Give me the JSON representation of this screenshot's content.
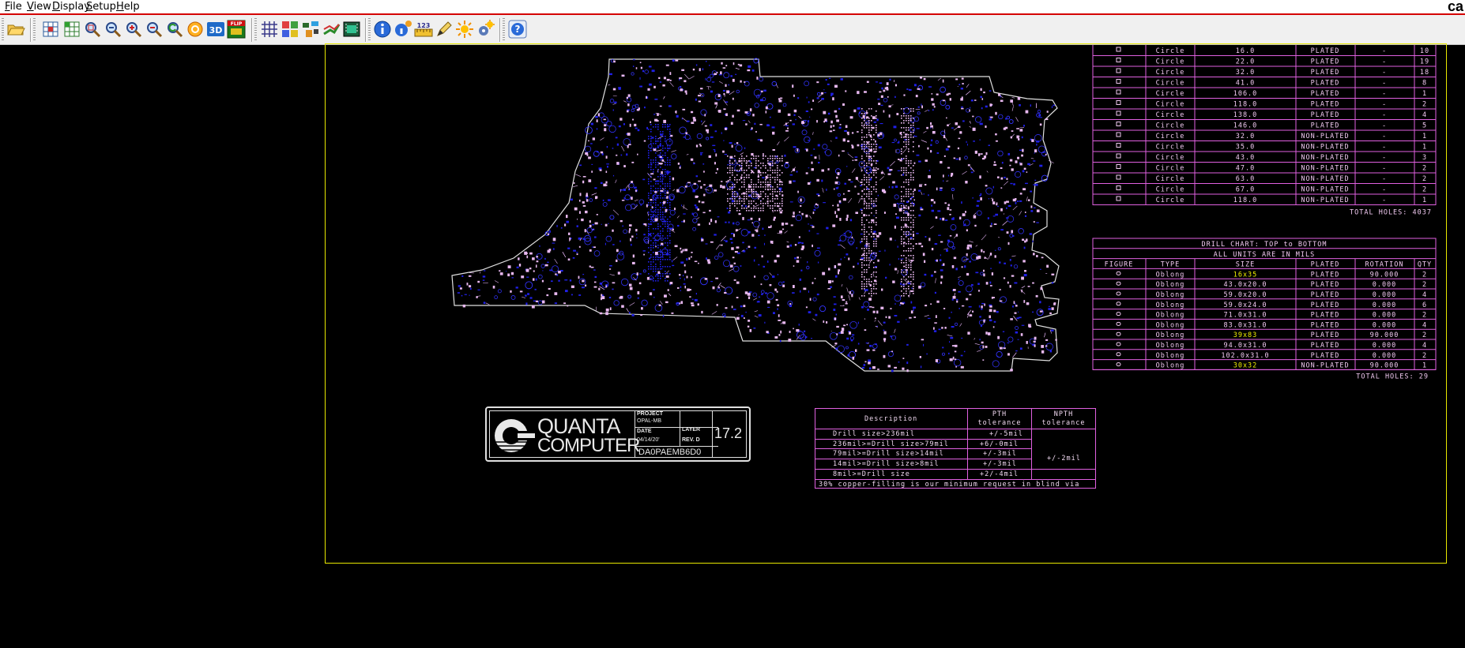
{
  "menu": [
    "File",
    "View",
    "Display",
    "Setup",
    "Help"
  ],
  "brand": "ca",
  "toolbar": {
    "icons": [
      "open-folder-icon",
      "grid-view-icon",
      "grid-view-2-icon",
      "zoom-area-icon",
      "zoom-fit-icon",
      "zoom-in-icon",
      "zoom-out-icon",
      "zoom-previous-icon",
      "refresh-icon",
      "view-3d-icon",
      "flip-board-icon",
      "grid-toggle-icon",
      "layers-icon",
      "components-icon",
      "nets-icon",
      "board-icon",
      "info-icon",
      "properties-icon",
      "measure-icon",
      "highlight-icon",
      "brightness-icon",
      "settings-icon",
      "help-icon"
    ],
    "label_3d": "3D",
    "label_flip": "FLIP",
    "label_measure": "123"
  },
  "drill_chart_upper": {
    "rows": [
      [
        "Circle",
        "16.0",
        "PLATED",
        "-",
        "10"
      ],
      [
        "Circle",
        "22.0",
        "PLATED",
        "-",
        "19"
      ],
      [
        "Circle",
        "32.0",
        "PLATED",
        "-",
        "18"
      ],
      [
        "Circle",
        "41.0",
        "PLATED",
        "-",
        "8"
      ],
      [
        "Circle",
        "106.0",
        "PLATED",
        "-",
        "1"
      ],
      [
        "Circle",
        "118.0",
        "PLATED",
        "-",
        "2"
      ],
      [
        "Circle",
        "138.0",
        "PLATED",
        "-",
        "4"
      ],
      [
        "Circle",
        "146.0",
        "PLATED",
        "-",
        "5"
      ],
      [
        "Circle",
        "32.0",
        "NON-PLATED",
        "-",
        "1"
      ],
      [
        "Circle",
        "35.0",
        "NON-PLATED",
        "-",
        "1"
      ],
      [
        "Circle",
        "43.0",
        "NON-PLATED",
        "-",
        "3"
      ],
      [
        "Circle",
        "47.0",
        "NON-PLATED",
        "-",
        "2"
      ],
      [
        "Circle",
        "63.0",
        "NON-PLATED",
        "-",
        "2"
      ],
      [
        "Circle",
        "67.0",
        "NON-PLATED",
        "-",
        "2"
      ],
      [
        "Circle",
        "118.0",
        "NON-PLATED",
        "-",
        "1"
      ]
    ],
    "total": "TOTAL HOLES:  4037"
  },
  "drill_chart_lower": {
    "title": "DRILL CHART: TOP to BOTTOM",
    "subtitle": "ALL UNITS ARE IN MILS",
    "headers": [
      "FIGURE",
      "TYPE",
      "SIZE",
      "PLATED",
      "ROTATION",
      "QTY"
    ],
    "rows": [
      [
        "Oblong",
        "16x35",
        "PLATED",
        "90.000",
        "2"
      ],
      [
        "Oblong",
        "43.0x20.0",
        "PLATED",
        "0.000",
        "2"
      ],
      [
        "Oblong",
        "59.0x20.0",
        "PLATED",
        "0.000",
        "4"
      ],
      [
        "Oblong",
        "59.0x24.0",
        "PLATED",
        "0.000",
        "6"
      ],
      [
        "Oblong",
        "71.0x31.0",
        "PLATED",
        "0.000",
        "2"
      ],
      [
        "Oblong",
        "83.0x31.0",
        "PLATED",
        "0.000",
        "4"
      ],
      [
        "Oblong",
        "39x83",
        "PLATED",
        "90.000",
        "2"
      ],
      [
        "Oblong",
        "94.0x31.0",
        "PLATED",
        "0.000",
        "4"
      ],
      [
        "Oblong",
        "102.0x31.0",
        "PLATED",
        "0.000",
        "2"
      ],
      [
        "Oblong",
        "30x32",
        "NON-PLATED",
        "90.000",
        "1"
      ]
    ],
    "highlight_rows": [
      0,
      6,
      9
    ],
    "total": "TOTAL HOLES:  29"
  },
  "titleblock": {
    "logo_line1": "QUANTA",
    "logo_line2": "COMPUTER",
    "project_label": "PROJECT",
    "project_value": "OPAL-MB",
    "date_label": "DATE",
    "date_value": "04/14/20'",
    "layer_label": "LAYER",
    "rev_label": "REV. D",
    "part_number": "DA0PAEMB6D0",
    "version": "17.2"
  },
  "tolerance": {
    "col_desc": "Description",
    "col_pth": "PTH tolerance",
    "col_npth": "NPTH tolerance",
    "rows": [
      [
        "Drill size>236mil",
        "+/-5mil",
        ""
      ],
      [
        "236mil>=Drill size>79mil",
        "+6/-0mil",
        ""
      ],
      [
        "79mil>=Drill size>14mil",
        "+/-3mil",
        "+/-2mil"
      ],
      [
        "14mil>=Drill size>8mil",
        "+/-3mil",
        ""
      ],
      [
        "8mil>=Drill size",
        "+2/-4mil",
        ""
      ]
    ],
    "note": "30% copper-filling is our minimum request in blind via"
  }
}
